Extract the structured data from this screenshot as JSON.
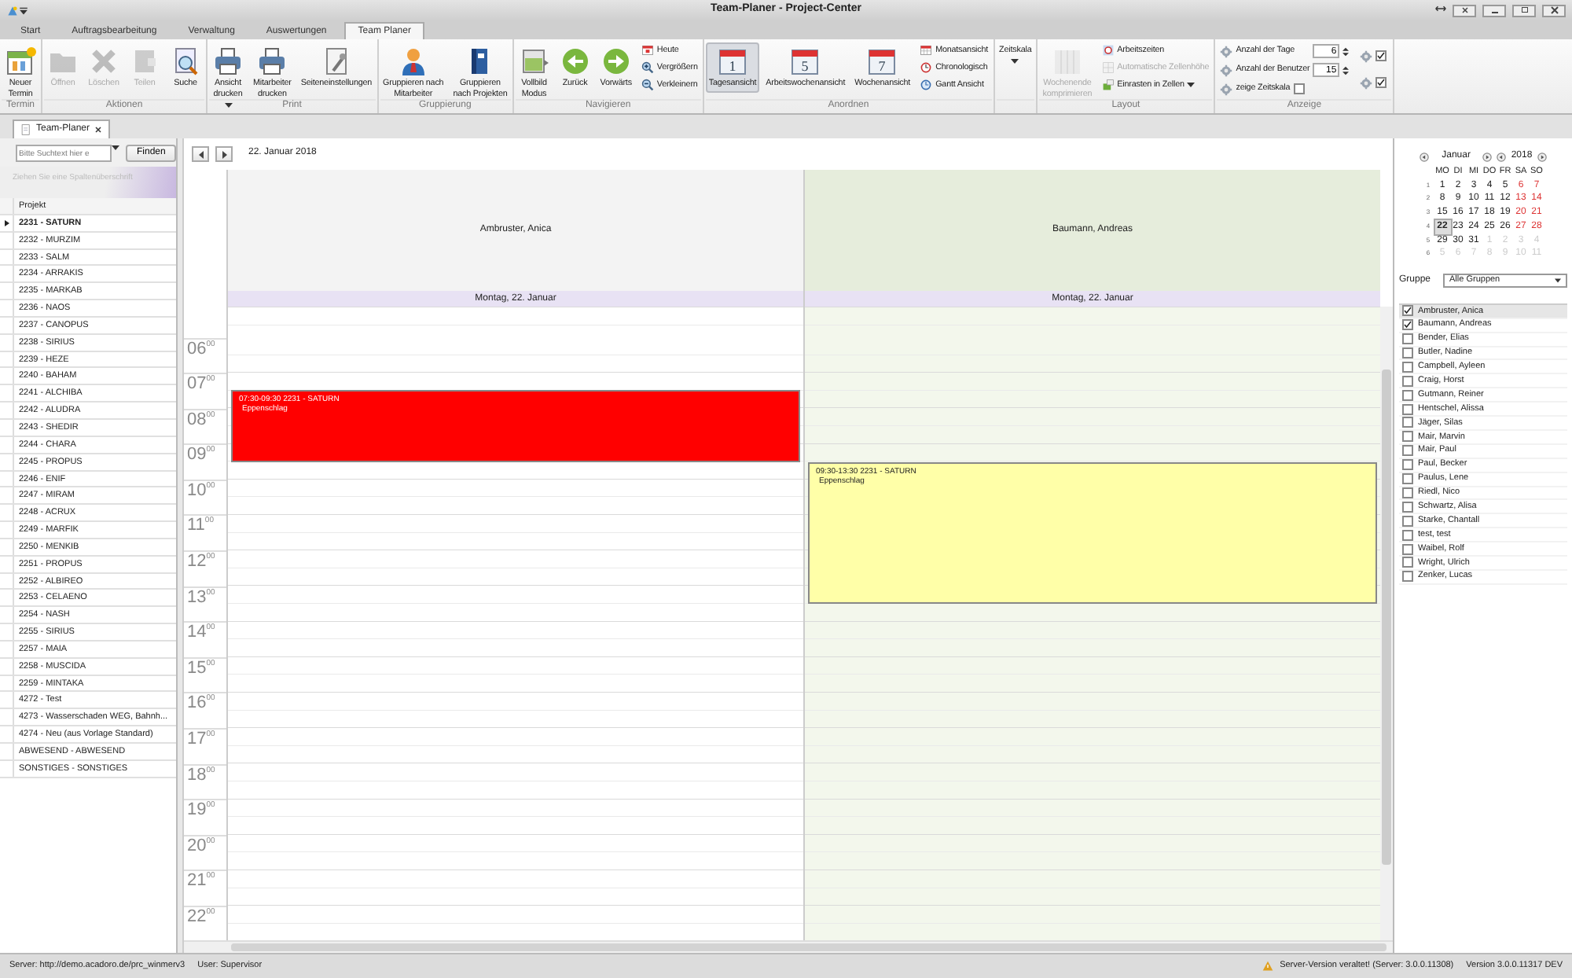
{
  "window": {
    "title": "Team-Planer - Project-Center"
  },
  "ribbon": {
    "tabs": [
      {
        "label": "Start",
        "selected": false
      },
      {
        "label": "Auftragsbearbeitung",
        "selected": false
      },
      {
        "label": "Verwaltung",
        "selected": false
      },
      {
        "label": "Auswertungen",
        "selected": false
      },
      {
        "label": "Team Planer",
        "selected": true
      }
    ],
    "groups": [
      {
        "label": "Termin",
        "items": [
          {
            "kind": "large",
            "label": "Neuer\nTermin",
            "disabled": false
          }
        ]
      },
      {
        "label": "Aktionen",
        "items": [
          {
            "kind": "large",
            "label": "Öffnen",
            "disabled": true
          },
          {
            "kind": "large",
            "label": "Löschen",
            "disabled": true
          },
          {
            "kind": "large",
            "label": "Teilen",
            "disabled": true
          },
          {
            "kind": "large",
            "label": "Suche",
            "disabled": false
          }
        ]
      },
      {
        "label": "Print",
        "items": [
          {
            "kind": "large",
            "label": "Ansicht\ndrucken",
            "disabled": false,
            "dropdown": true
          },
          {
            "kind": "large",
            "label": "Mitarbeiter\ndrucken",
            "disabled": false
          },
          {
            "kind": "large",
            "label": "Seiteneinstellungen",
            "disabled": false
          }
        ]
      },
      {
        "label": "Gruppierung",
        "items": [
          {
            "kind": "large",
            "label": "Gruppieren nach\nMitarbeiter",
            "disabled": false
          },
          {
            "kind": "large",
            "label": "Gruppieren\nnach Projekten",
            "disabled": false
          }
        ]
      },
      {
        "label": "Navigieren",
        "items": [
          {
            "kind": "large",
            "label": "Vollbild\nModus",
            "disabled": false
          },
          {
            "kind": "large",
            "label": "Zurück",
            "disabled": false
          },
          {
            "kind": "large",
            "label": "Vorwärts",
            "disabled": false
          },
          {
            "kind": "stack",
            "items": [
              {
                "label": "Heute",
                "disabled": false
              },
              {
                "label": "Vergrößern",
                "disabled": false
              },
              {
                "label": "Verkleinern",
                "disabled": false
              }
            ]
          }
        ]
      },
      {
        "label": "Anordnen",
        "items": [
          {
            "kind": "large",
            "label": "Tagesansicht",
            "disabled": false,
            "selected": true,
            "badge": "1"
          },
          {
            "kind": "large",
            "label": "Arbeitswochenansicht",
            "disabled": false,
            "selected": false,
            "badge": "5"
          },
          {
            "kind": "large",
            "label": "Wochenansicht",
            "disabled": false,
            "selected": false,
            "badge": "7"
          },
          {
            "kind": "stack",
            "items": [
              {
                "label": "Monatsansicht",
                "disabled": false
              },
              {
                "label": "Chronologisch",
                "disabled": false
              },
              {
                "label": "Gantt Ansicht",
                "disabled": false
              }
            ]
          }
        ]
      },
      {
        "items": [
          {
            "kind": "large",
            "label": "Zeitskala",
            "disabled": false,
            "dropdown": true
          }
        ]
      },
      {
        "label": "Layout",
        "items": [
          {
            "kind": "large",
            "label": "Wochenende\nkomprimieren",
            "disabled": true
          },
          {
            "kind": "stack",
            "items": [
              {
                "label": "Arbeitszeiten",
                "disabled": false
              },
              {
                "label": "Automatische Zellenhöhe",
                "disabled": true
              },
              {
                "label": "Einrasten in Zellen",
                "disabled": false,
                "dropdown": true
              }
            ]
          }
        ]
      },
      {
        "label": "Anzeige",
        "items": [
          {
            "kind": "settings",
            "rows": [
              {
                "label": "Anzahl der Tage",
                "value": "6"
              },
              {
                "label": "Anzahl der Benutzer",
                "value": "15"
              },
              {
                "label": "zeige Zeitskala",
                "checked": false
              }
            ]
          },
          {
            "kind": "toggles",
            "rows": [
              {
                "checked": true
              },
              {
                "checked": true
              }
            ]
          }
        ]
      }
    ]
  },
  "document_tab": {
    "label": "Team-Planer"
  },
  "projects": {
    "search": {
      "placeholder": "Bitte Suchtext hier e"
    },
    "find_button": "Finden",
    "group_hint": "Ziehen Sie eine Spaltenüberschrift",
    "column": "Projekt",
    "rows": [
      {
        "label": "2231 - SATURN",
        "selected": true
      },
      {
        "label": "2232 - MURZIM",
        "selected": false
      },
      {
        "label": "2233 - SALM",
        "selected": false
      },
      {
        "label": "2234 - ARRAKIS",
        "selected": false
      },
      {
        "label": "2235 - MARKAB",
        "selected": false
      },
      {
        "label": "2236 - NAOS",
        "selected": false
      },
      {
        "label": "2237 - CANOPUS",
        "selected": false
      },
      {
        "label": "2238 - SIRIUS",
        "selected": false
      },
      {
        "label": "2239 - HEZE",
        "selected": false
      },
      {
        "label": "2240 - BAHAM",
        "selected": false
      },
      {
        "label": "2241 - ALCHIBA",
        "selected": false
      },
      {
        "label": "2242 - ALUDRA",
        "selected": false
      },
      {
        "label": "2243 - SHEDIR",
        "selected": false
      },
      {
        "label": "2244 - CHARA",
        "selected": false
      },
      {
        "label": "2245 - PROPUS",
        "selected": false
      },
      {
        "label": "2246 - ENIF",
        "selected": false
      },
      {
        "label": "2247 - MIRAM",
        "selected": false
      },
      {
        "label": "2248 - ACRUX",
        "selected": false
      },
      {
        "label": "2249 - MARFIK",
        "selected": false
      },
      {
        "label": "2250 - MENKIB",
        "selected": false
      },
      {
        "label": "2251 - PROPUS",
        "selected": false
      },
      {
        "label": "2252 - ALBIREO",
        "selected": false
      },
      {
        "label": "2253 - CELAENO",
        "selected": false
      },
      {
        "label": "2254 - NASH",
        "selected": false
      },
      {
        "label": "2255 - SIRIUS",
        "selected": false
      },
      {
        "label": "2257 - MAIA",
        "selected": false
      },
      {
        "label": "2258 - MUSCIDA",
        "selected": false
      },
      {
        "label": "2259 - MINTAKA",
        "selected": false
      },
      {
        "label": "4272 - Test",
        "selected": false
      },
      {
        "label": "4273 - Wasserschaden WEG, Bahnh...",
        "selected": false
      },
      {
        "label": "4274 - Neu (aus Vorlage Standard)",
        "selected": false
      },
      {
        "label": "ABWESEND - ABWESEND",
        "selected": false
      },
      {
        "label": "SONSTIGES - SONSTIGES",
        "selected": false
      }
    ]
  },
  "scheduler": {
    "date": "22. Januar 2018",
    "hours": [
      {
        "h": "06",
        "m": "00"
      },
      {
        "h": "07",
        "m": "00"
      },
      {
        "h": "08",
        "m": "00"
      },
      {
        "h": "09",
        "m": "00"
      },
      {
        "h": "10",
        "m": "00"
      },
      {
        "h": "11",
        "m": "00"
      },
      {
        "h": "12",
        "m": "00"
      },
      {
        "h": "13",
        "m": "00"
      },
      {
        "h": "14",
        "m": "00"
      },
      {
        "h": "15",
        "m": "00"
      },
      {
        "h": "16",
        "m": "00"
      },
      {
        "h": "17",
        "m": "00"
      },
      {
        "h": "18",
        "m": "00"
      },
      {
        "h": "19",
        "m": "00"
      },
      {
        "h": "20",
        "m": "00"
      },
      {
        "h": "21",
        "m": "00"
      },
      {
        "h": "22",
        "m": "00"
      }
    ],
    "columns": [
      {
        "name": "Ambruster, Anica",
        "color": "#f3f3f3",
        "day": "Montag, 22. Januar",
        "events": [
          {
            "time": "07:30-09:30",
            "project": "2231 - SATURN",
            "note": "Eppenschlag",
            "color": "#ff0000"
          }
        ]
      },
      {
        "name": "Baumann, Andreas",
        "color": "#e6eddc",
        "day": "Montag, 22. Januar",
        "events": [
          {
            "time": "09:30-13:30",
            "project": "2231 - SATURN",
            "note": "Eppenschlag",
            "color": "#ffffa8"
          }
        ]
      }
    ]
  },
  "mini_calendar": {
    "month": "Januar",
    "year": "2018",
    "weekdays": [
      "MO",
      "DI",
      "MI",
      "DO",
      "FR",
      "SA",
      "SO"
    ],
    "weeks": [
      {
        "week": "1",
        "days": [
          {
            "day": "1",
            "outside": false,
            "selected": false
          },
          {
            "day": "2",
            "outside": false,
            "selected": false
          },
          {
            "day": "3",
            "outside": false,
            "selected": false
          },
          {
            "day": "4",
            "outside": false,
            "selected": false
          },
          {
            "day": "5",
            "outside": false,
            "selected": false
          },
          {
            "day": "6",
            "outside": false,
            "selected": false
          },
          {
            "day": "7",
            "outside": false,
            "selected": false
          }
        ]
      },
      {
        "week": "2",
        "days": [
          {
            "day": "8",
            "outside": false,
            "selected": false
          },
          {
            "day": "9",
            "outside": false,
            "selected": false
          },
          {
            "day": "10",
            "outside": false,
            "selected": false
          },
          {
            "day": "11",
            "outside": false,
            "selected": false
          },
          {
            "day": "12",
            "outside": false,
            "selected": false
          },
          {
            "day": "13",
            "outside": false,
            "selected": false
          },
          {
            "day": "14",
            "outside": false,
            "selected": false
          }
        ]
      },
      {
        "week": "3",
        "days": [
          {
            "day": "15",
            "outside": false,
            "selected": false
          },
          {
            "day": "16",
            "outside": false,
            "selected": false
          },
          {
            "day": "17",
            "outside": false,
            "selected": false
          },
          {
            "day": "18",
            "outside": false,
            "selected": false
          },
          {
            "day": "19",
            "outside": false,
            "selected": false
          },
          {
            "day": "20",
            "outside": false,
            "selected": false
          },
          {
            "day": "21",
            "outside": false,
            "selected": false
          }
        ]
      },
      {
        "week": "4",
        "days": [
          {
            "day": "22",
            "outside": false,
            "selected": true
          },
          {
            "day": "23",
            "outside": false,
            "selected": false
          },
          {
            "day": "24",
            "outside": false,
            "selected": false
          },
          {
            "day": "25",
            "outside": false,
            "selected": false
          },
          {
            "day": "26",
            "outside": false,
            "selected": false
          },
          {
            "day": "27",
            "outside": false,
            "selected": false
          },
          {
            "day": "28",
            "outside": false,
            "selected": false
          }
        ]
      },
      {
        "week": "5",
        "days": [
          {
            "day": "29",
            "outside": false,
            "selected": false
          },
          {
            "day": "30",
            "outside": false,
            "selected": false
          },
          {
            "day": "31",
            "outside": false,
            "selected": false
          },
          {
            "day": "1",
            "outside": true,
            "selected": false
          },
          {
            "day": "2",
            "outside": true,
            "selected": false
          },
          {
            "day": "3",
            "outside": true,
            "selected": false
          },
          {
            "day": "4",
            "outside": true,
            "selected": false
          }
        ]
      },
      {
        "week": "6",
        "days": [
          {
            "day": "5",
            "outside": true,
            "selected": false
          },
          {
            "day": "6",
            "outside": true,
            "selected": false
          },
          {
            "day": "7",
            "outside": true,
            "selected": false
          },
          {
            "day": "8",
            "outside": true,
            "selected": false
          },
          {
            "day": "9",
            "outside": true,
            "selected": false
          },
          {
            "day": "10",
            "outside": true,
            "selected": false
          },
          {
            "day": "11",
            "outside": true,
            "selected": false
          }
        ]
      }
    ]
  },
  "group_filter": {
    "label": "Gruppe",
    "value": "Alle Gruppen"
  },
  "employees": [
    {
      "name": "Ambruster, Anica",
      "checked": true,
      "selected": true
    },
    {
      "name": "Baumann, Andreas",
      "checked": true,
      "selected": false
    },
    {
      "name": "Bender, Elias",
      "checked": false,
      "selected": false
    },
    {
      "name": "Butler, Nadine",
      "checked": false,
      "selected": false
    },
    {
      "name": "Campbell, Ayleen",
      "checked": false,
      "selected": false
    },
    {
      "name": "Craig, Horst",
      "checked": false,
      "selected": false
    },
    {
      "name": "Gutmann, Reiner",
      "checked": false,
      "selected": false
    },
    {
      "name": "Hentschel, Alissa",
      "checked": false,
      "selected": false
    },
    {
      "name": "Jäger, Silas",
      "checked": false,
      "selected": false
    },
    {
      "name": "Mair, Marvin",
      "checked": false,
      "selected": false
    },
    {
      "name": "Mair, Paul",
      "checked": false,
      "selected": false
    },
    {
      "name": "Paul, Becker",
      "checked": false,
      "selected": false
    },
    {
      "name": "Paulus, Lene",
      "checked": false,
      "selected": false
    },
    {
      "name": "Riedl, Nico",
      "checked": false,
      "selected": false
    },
    {
      "name": "Schwartz, Alisa",
      "checked": false,
      "selected": false
    },
    {
      "name": "Starke, Chantall",
      "checked": false,
      "selected": false
    },
    {
      "name": "test, test",
      "checked": false,
      "selected": false
    },
    {
      "name": "Waibel, Rolf",
      "checked": false,
      "selected": false
    },
    {
      "name": "Wright, Ulrich",
      "checked": false,
      "selected": false
    },
    {
      "name": "Zenker, Lucas",
      "checked": false,
      "selected": false
    }
  ],
  "status_bar": {
    "server": "Server: http://demo.acadoro.de/prc_winmerv3",
    "user": "User: Supervisor",
    "warning": "Server-Version veraltet! (Server: 3.0.0.11308)",
    "version": "Version 3.0.0.11317 DEV"
  }
}
